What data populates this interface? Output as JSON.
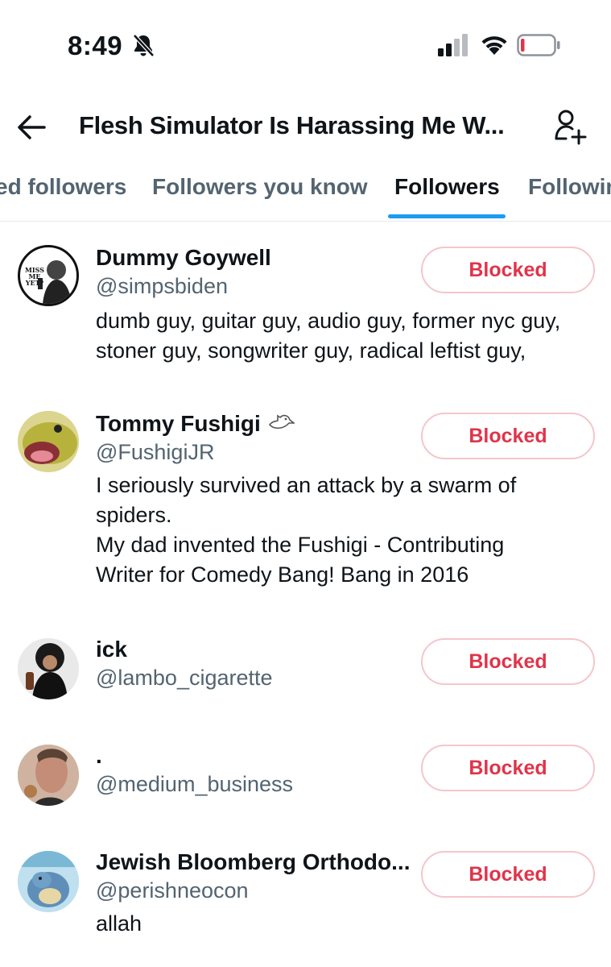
{
  "status_bar": {
    "time": "8:49"
  },
  "header": {
    "title": "Flesh Simulator Is Harassing Me W..."
  },
  "tabs": [
    {
      "label": "ed followers"
    },
    {
      "label": "Followers you know"
    },
    {
      "label": "Followers",
      "active": true
    },
    {
      "label": "Followin"
    }
  ],
  "users": [
    {
      "name": "Dummy Goywell",
      "handle": "@simpsbiden",
      "bio": [
        "dumb guy, guitar guy, audio guy, former nyc guy,",
        "stoner guy, songwriter guy, radical leftist guy,"
      ],
      "button": "Blocked",
      "avatar_text": "MISS ME YET?"
    },
    {
      "name": "Tommy Fushigi",
      "handle": "@FushigiJR",
      "bio": [
        "I seriously survived an attack by a swarm of",
        "spiders.",
        "My dad invented the Fushigi - Contributing",
        "Writer for Comedy Bang! Bang in 2016"
      ],
      "button": "Blocked"
    },
    {
      "name": "ick",
      "handle": "@lambo_cigarette",
      "bio": [],
      "button": "Blocked"
    },
    {
      "name": ".",
      "handle": "@medium_business",
      "bio": [],
      "button": "Blocked"
    },
    {
      "name": "Jewish Bloomberg Orthodo...",
      "handle": "@perishneocon",
      "bio": [
        "allah"
      ],
      "button": "Blocked"
    }
  ],
  "colors": {
    "accent": "#1d9bf0",
    "blocked_text": "#e0344a",
    "blocked_border": "#f4c6cb",
    "secondary_text": "#536471"
  }
}
